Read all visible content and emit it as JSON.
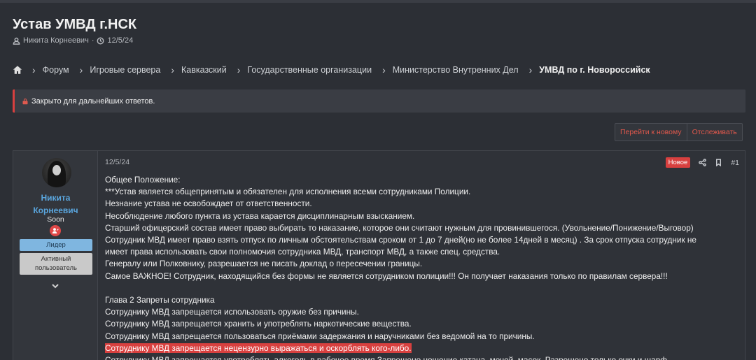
{
  "thread": {
    "title": "Устав УМВД г.НСК",
    "author": "Никита Корнеевич",
    "date": "12/5/24"
  },
  "breadcrumb": [
    {
      "label": "Форум"
    },
    {
      "label": "Игровые сервера"
    },
    {
      "label": "Кавказский"
    },
    {
      "label": "Государственные организации"
    },
    {
      "label": "Министерство Внутренних Дел"
    },
    {
      "label": "УМВД по г. Новороссийск"
    }
  ],
  "notice": {
    "text": "Закрыто для дальнейших ответов."
  },
  "actions": {
    "go_new": "Перейти к новому",
    "watch": "Отслеживать"
  },
  "post": {
    "date": "12/5/24",
    "new_badge": "Новое",
    "number": "#1",
    "user": {
      "name_line1": "Никита",
      "name_line2": "Корнеевич",
      "title": "Soon",
      "role_leader": "Лидер",
      "role_active_line1": "Активный",
      "role_active_line2": "пользователь"
    },
    "lines": [
      "Общее Положение:",
      "***Устав является общепринятым и обязателен для исполнения всеми сотрудниками Полиции.",
      "Незнание устава не освобождает от ответственности.",
      "Несоблюдение любого пункта из устава карается дисциплинарным взысканием.",
      "Старший офицерский состав имеет право выбирать то наказание, которое они считают нужным для провинившегося. (Увольнение/Понижение/Выговор)",
      "Сотрудник МВД имеет право взять отпуск по личным обстоятельствам сроком от 1 до 7 дней(но не более 14дней в месяц) . За срок отпуска сотрудник не",
      "имеет права использовать свои полномочия сотрудника МВД, транспорт МВД, а также спец. средства.",
      "Генералу или Полковнику, разрешается не писать доклад о пересечении границы.",
      "Самое ВАЖНОЕ! Сотрудник, находящийся без формы не является сотрудником полиции!!! Он получает наказания только по правилам сервера!!!",
      "",
      "Глава 2 Запреты сотрудника",
      "Сотруднику МВД запрещается использовать оружие без причины.",
      "Сотруднику МВД запрещается хранить и употреблять наркотические вещества.",
      "Сотруднику МВД запрещается пользоваться приёмами задержания и наручниками без ведомой на то причины.",
      "Сотруднику МВД запрещается нецензурно выражаться и оскорблять кого-либо.",
      "Сотруднику МВД запрещается употреблять алкоголь в рабочее время Запрещено ношение катана, мечей, масок. Разрешено только очки и шарф"
    ],
    "highlight_line_index": 14
  }
}
